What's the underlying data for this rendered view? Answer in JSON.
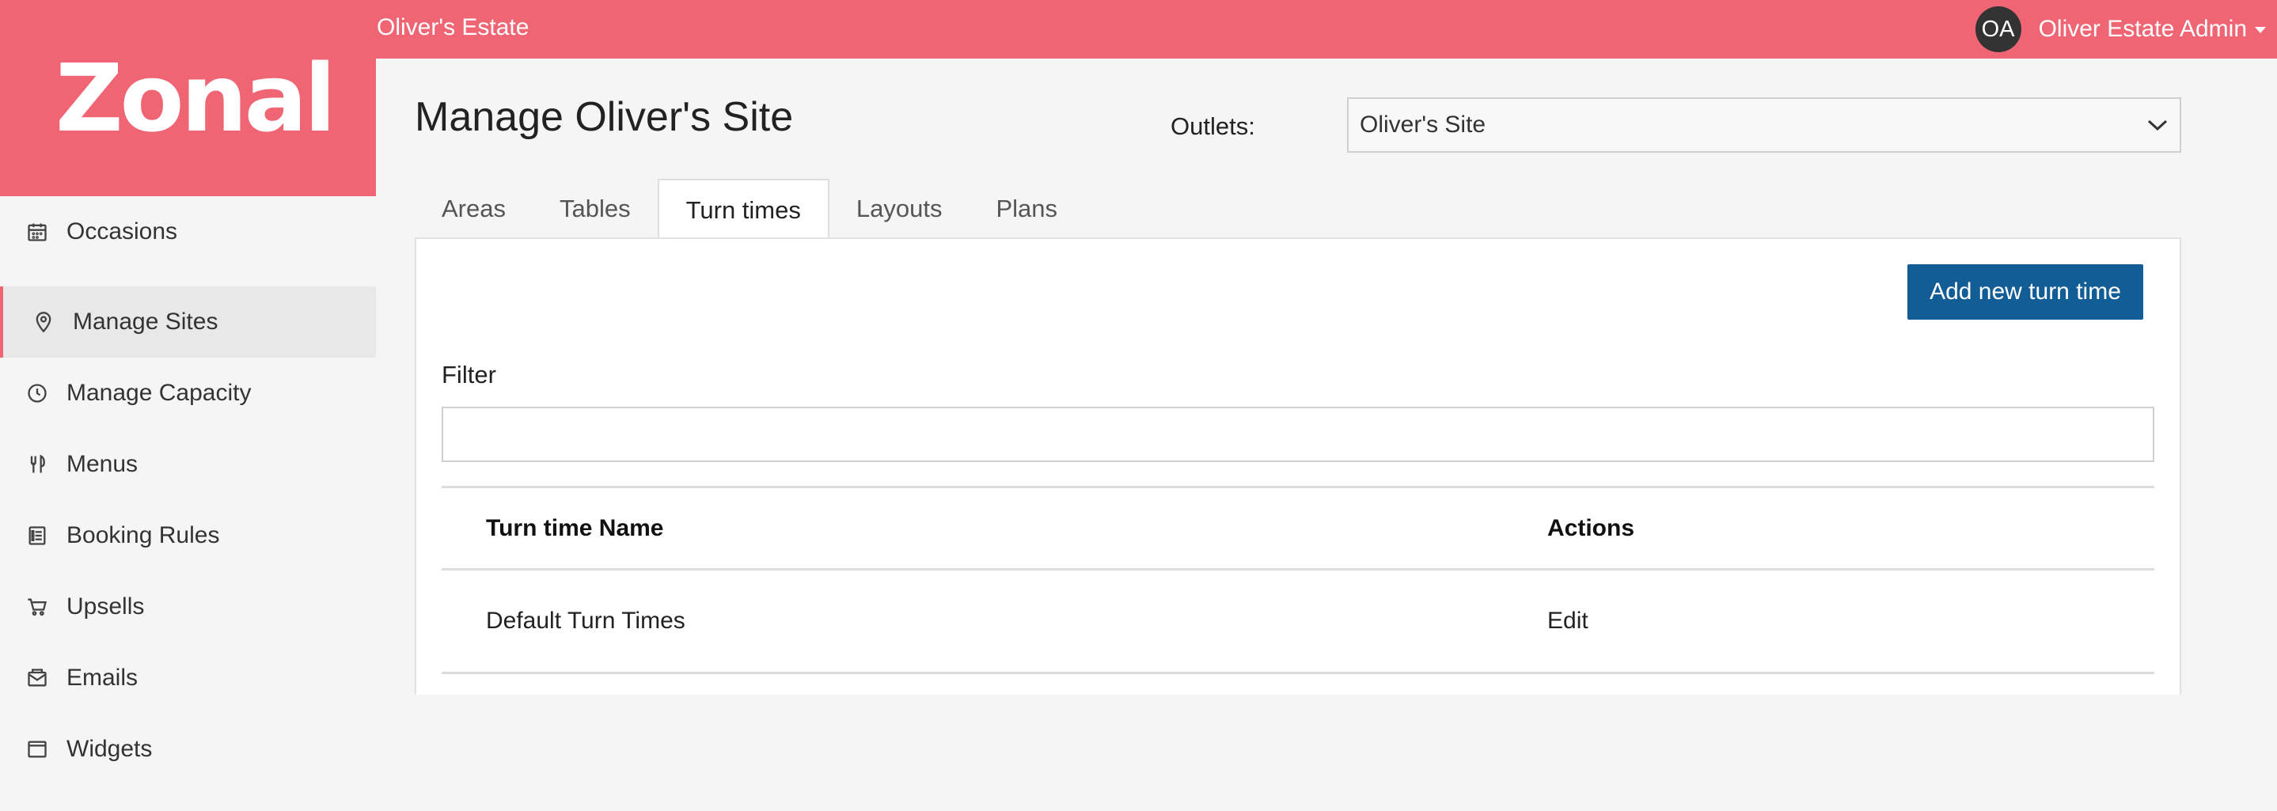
{
  "topbar": {
    "estate_name": "Oliver's Estate",
    "avatar_initials": "OA",
    "user_name": "Oliver Estate Admin",
    "background": "#ef6574"
  },
  "brand": {
    "logo_text": "Zonal"
  },
  "sidebar": {
    "items": [
      {
        "label": "Occasions",
        "icon": "calendar-icon",
        "active": false
      },
      {
        "label": "Manage Sites",
        "icon": "map-pin-icon",
        "active": true
      },
      {
        "label": "Manage Capacity",
        "icon": "clock-icon",
        "active": false
      },
      {
        "label": "Menus",
        "icon": "cutlery-icon",
        "active": false
      },
      {
        "label": "Booking Rules",
        "icon": "list-icon",
        "active": false
      },
      {
        "label": "Upsells",
        "icon": "cart-icon",
        "active": false
      },
      {
        "label": "Emails",
        "icon": "email-icon",
        "active": false
      },
      {
        "label": "Widgets",
        "icon": "window-icon",
        "active": false
      }
    ]
  },
  "main": {
    "title": "Manage Oliver's Site",
    "outlets_label": "Outlets:",
    "outlets_selected": "Oliver's Site",
    "tabs": [
      {
        "label": "Areas",
        "active": false
      },
      {
        "label": "Tables",
        "active": false
      },
      {
        "label": "Turn times",
        "active": true
      },
      {
        "label": "Layouts",
        "active": false
      },
      {
        "label": "Plans",
        "active": false
      }
    ],
    "add_button_label": "Add new turn time",
    "filter_label": "Filter",
    "filter_value": "",
    "table": {
      "headers": [
        "Turn time Name",
        "Actions"
      ],
      "rows": [
        {
          "name": "Default Turn Times",
          "action": "Edit"
        }
      ]
    }
  },
  "colors": {
    "accent": "#ef6574",
    "primary_button": "#135d96",
    "link": "#1d5f96"
  }
}
